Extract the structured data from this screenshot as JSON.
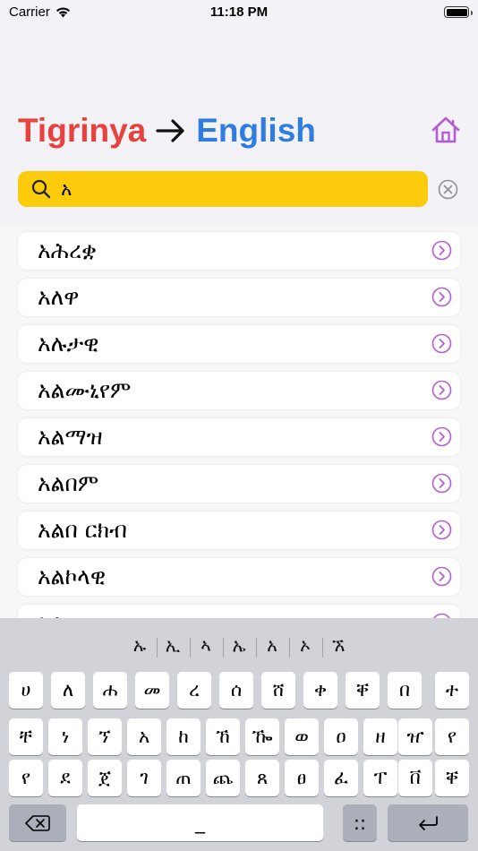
{
  "status": {
    "carrier": "Carrier",
    "time": "11:18 PM"
  },
  "header": {
    "from_lang": "Tigrinya",
    "to_lang": "English",
    "home_icon": "home-icon",
    "accent": "#b45bd6"
  },
  "search": {
    "value": "አ",
    "clear_icon": "close-circle-icon"
  },
  "colors": {
    "from": "#e8413e",
    "to": "#2f7de1",
    "search_bg": "#fccc0c"
  },
  "results": [
    "አሕረቋ",
    "አለዋ",
    "አሉታዊ",
    "አልሙኒየም",
    "አልማዝ",
    "አልበም",
    "አልበ ርክብ",
    "አልኮላዊ",
    "አል"
  ],
  "keyboard": {
    "suggestions": [
      "ኡ",
      "ኢ",
      "ኣ",
      "ኤ",
      "አ",
      "ኦ",
      "ኧ"
    ],
    "row1": [
      "ሀ",
      "ለ",
      "ሐ",
      "መ",
      "ረ",
      "ሰ",
      "ሸ",
      "ቀ",
      "ቐ",
      "በ",
      "ተ"
    ],
    "row2": [
      "ቸ",
      "ነ",
      "ኘ",
      "አ",
      "ከ",
      "ኸ",
      "ዀ",
      "ወ",
      "ዐ",
      "ዘ",
      "ዠ",
      "የ"
    ],
    "row3": [
      "የ",
      "ደ",
      "ጀ",
      "ገ",
      "ጠ",
      "ጨ",
      "ጸ",
      "ፀ",
      "ፈ",
      "ፐ",
      "ቨ",
      "ቐ"
    ],
    "space_label": "_",
    "globe_label": "::",
    "delete_icon": "backspace-icon",
    "return_icon": "return-icon"
  }
}
